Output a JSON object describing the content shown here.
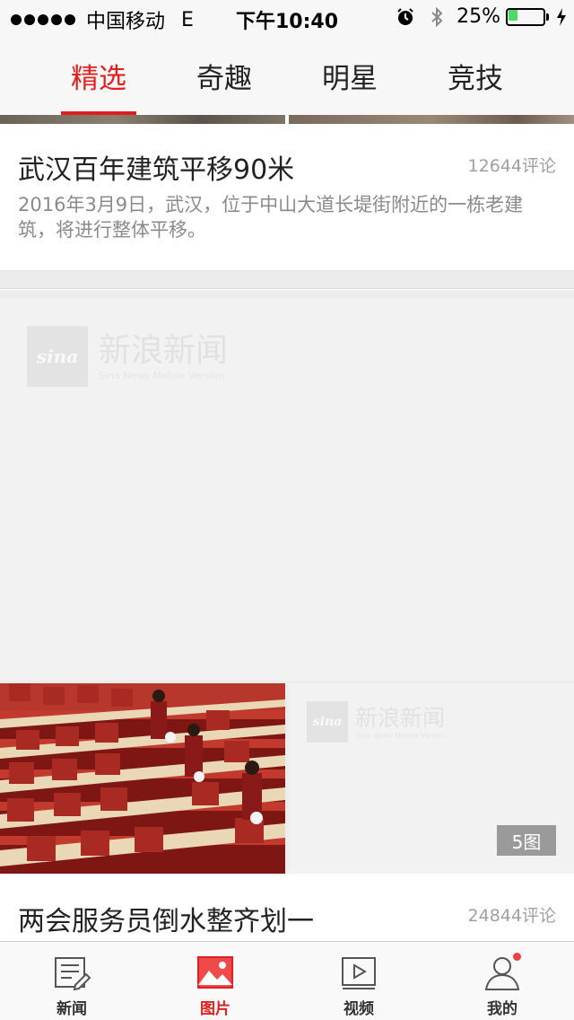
{
  "status_bar": {
    "carrier": "中国移动",
    "network": "E",
    "time": "下午10:40",
    "battery_percent_label": "25%",
    "battery_level": 0.25,
    "icons": [
      "signal-dots-icon",
      "alarm-icon",
      "bluetooth-icon",
      "battery-icon",
      "charging-icon"
    ]
  },
  "category_tabs": [
    {
      "label": "精选",
      "active": true
    },
    {
      "label": "奇趣",
      "active": false
    },
    {
      "label": "明星",
      "active": false
    },
    {
      "label": "竞技",
      "active": false
    }
  ],
  "article1": {
    "title": "武汉百年建筑平移90米",
    "comments": "12644评论",
    "summary": "2016年3月9日，武汉，位于中山大道长堤街附近的一栋老建筑，将进行整体平移。"
  },
  "photo_card": {
    "watermark_main": {
      "cn": "新浪新闻",
      "en": "Sina News Mobile Version",
      "logo": "sina"
    },
    "watermark_thumb": {
      "cn": "新浪新闻",
      "en": "Sina News Mobile Version",
      "logo": "sina"
    },
    "image_count_badge": "5图",
    "title": "两会服务员倒水整齐划一",
    "comments": "24844评论"
  },
  "tab_bar": {
    "items": [
      {
        "label": "新闻",
        "icon": "news-icon",
        "active": false
      },
      {
        "label": "图片",
        "icon": "picture-icon",
        "active": true
      },
      {
        "label": "视频",
        "icon": "video-icon",
        "active": false
      },
      {
        "label": "我的",
        "icon": "profile-icon",
        "active": false,
        "has_notification": true
      }
    ]
  },
  "colors": {
    "accent": "#e02020",
    "battery": "#4cd964",
    "muted_text": "#a0a0a0"
  }
}
